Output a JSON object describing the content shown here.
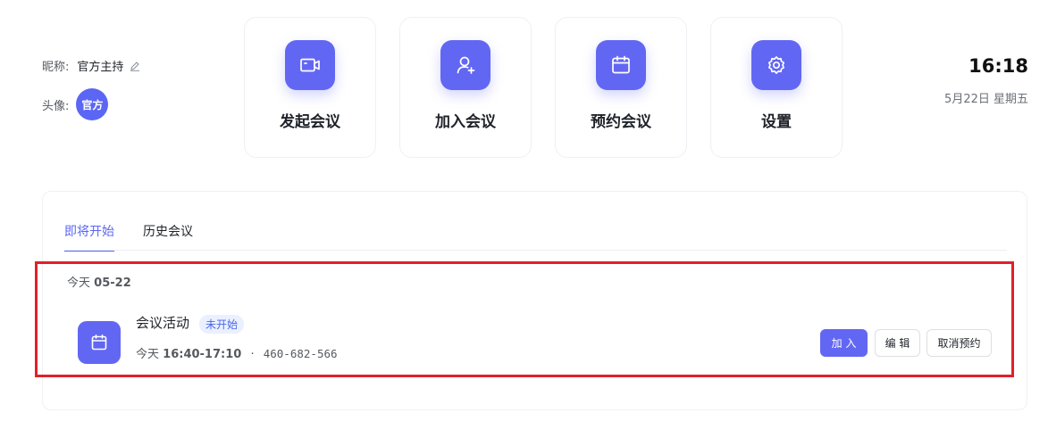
{
  "profile": {
    "nickname_label": "昵称:",
    "nickname": "官方主持",
    "avatar_label": "头像:",
    "avatar_text": "官方"
  },
  "actions": [
    {
      "label": "发起会议",
      "icon": "video-camera-icon"
    },
    {
      "label": "加入会议",
      "icon": "add-user-icon"
    },
    {
      "label": "预约会议",
      "icon": "calendar-icon"
    },
    {
      "label": "设置",
      "icon": "gear-icon"
    }
  ],
  "clock": {
    "time": "16:18",
    "date": "5月22日 星期五"
  },
  "tabs": [
    {
      "label": "即将开始",
      "active": true
    },
    {
      "label": "历史会议",
      "active": false
    }
  ],
  "meetings": {
    "date_prefix": "今天",
    "date_value": "05-22",
    "items": [
      {
        "title": "会议活动",
        "status": "未开始",
        "time_prefix": "今天",
        "time_range": "16:40-17:10",
        "separator": "·",
        "meeting_id": "460-682-566",
        "join_label": "加 入",
        "edit_label": "编 辑",
        "cancel_label": "取消预约"
      }
    ]
  },
  "colors": {
    "accent": "#6267f3",
    "highlight": "#e0202a"
  }
}
